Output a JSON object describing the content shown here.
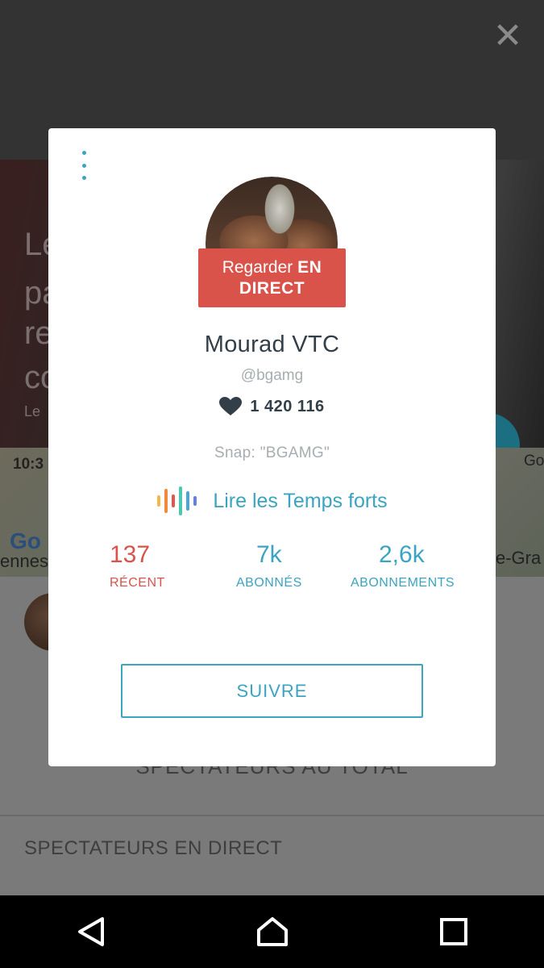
{
  "background": {
    "photo_text_lines": [
      "Le",
      "pa",
      "re",
      "co"
    ],
    "photo_caption": "Le",
    "map_time": "10:3",
    "map_left_label": "ennes",
    "map_right_label": "e-Gra",
    "map_top_right_label": "Go",
    "google_logo": "Go",
    "total_viewers_label": "SPECTATEURS AU TOTAL",
    "live_viewers_label": "SPECTATEURS EN DIRECT"
  },
  "close_icon": "close-icon",
  "profile": {
    "watch_live_prefix": "Regarder",
    "watch_live_bold": "EN DIRECT",
    "name": "Mourad VTC",
    "handle": "@bgamg",
    "hearts": "1 420 116",
    "bio": "Snap: \"BGAMG\"",
    "highlights_label": "Lire les Temps forts",
    "stats": [
      {
        "value": "137",
        "label": "RÉCENT",
        "color": "#d9534a"
      },
      {
        "value": "7k",
        "label": "ABONNÉS",
        "color": "#3aa4c2"
      },
      {
        "value": "2,6k",
        "label": "ABONNEMENTS",
        "color": "#3aa4c2"
      }
    ],
    "follow_label": "SUIVRE"
  },
  "colors": {
    "accent_blue": "#3aa4c2",
    "live_red": "#d9534a",
    "text_dark": "#333f48",
    "text_muted": "#a7adb0"
  },
  "navbar": {
    "back_icon": "back-triangle-icon",
    "home_icon": "home-icon",
    "recents_icon": "recents-square-icon"
  }
}
